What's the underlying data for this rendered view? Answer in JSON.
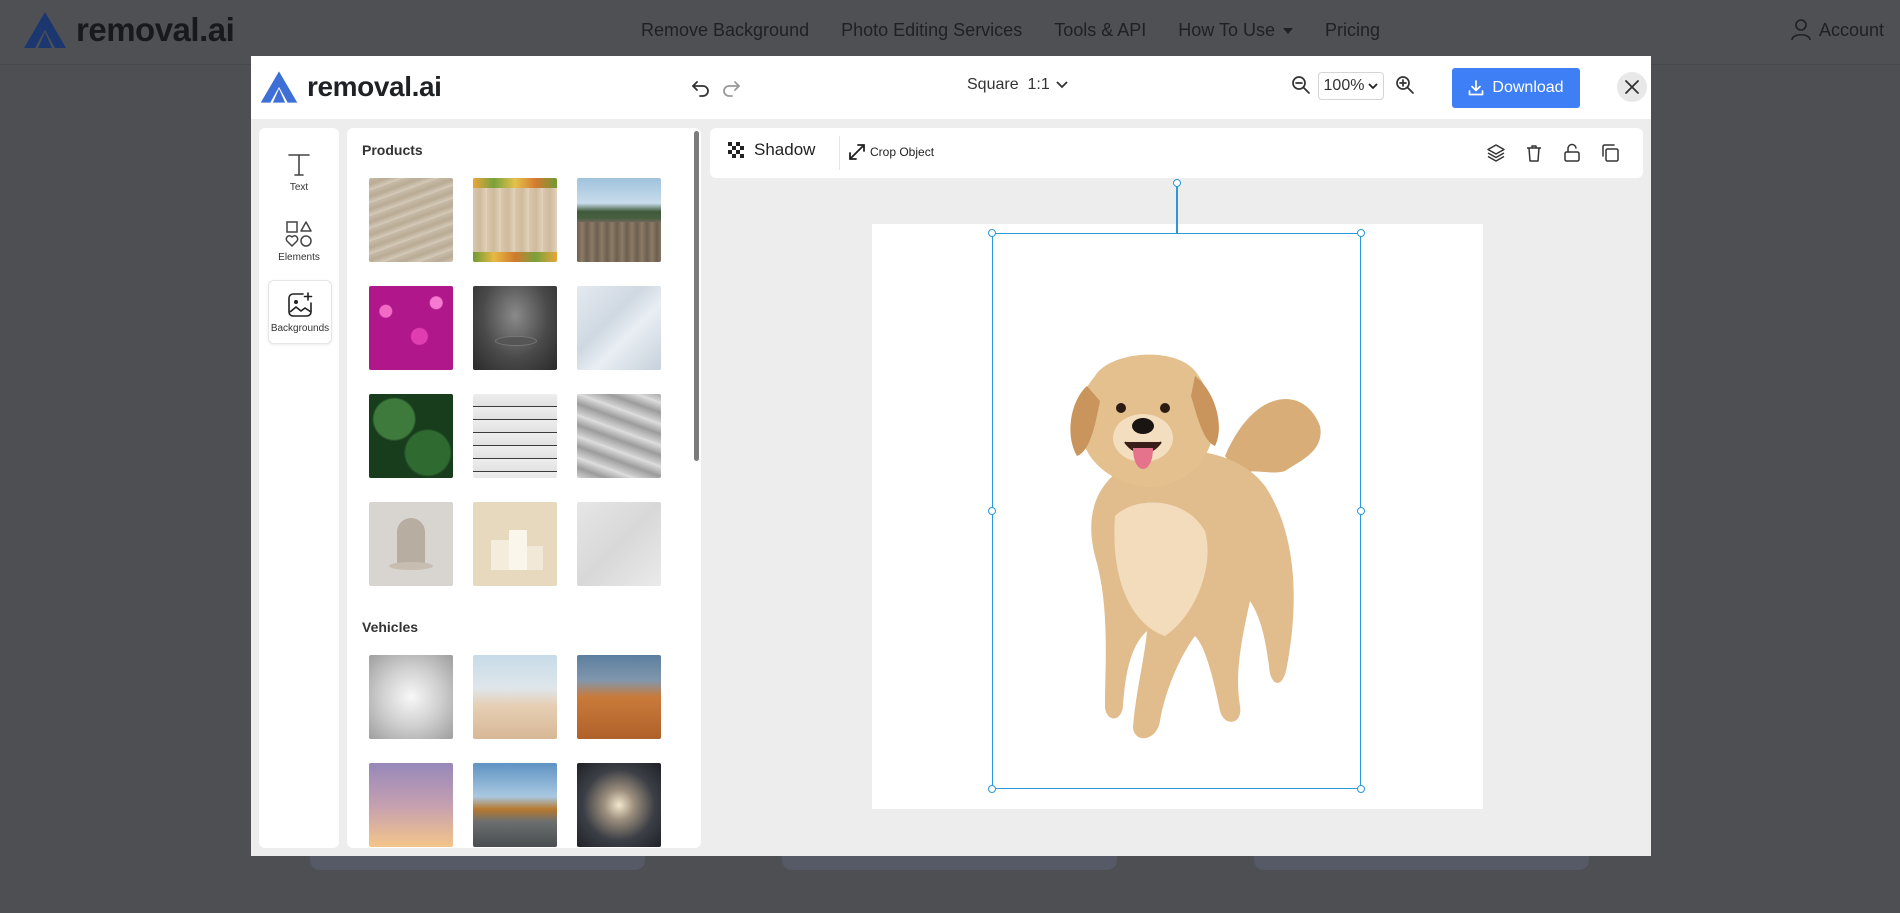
{
  "site": {
    "logo_text": "removal.ai",
    "nav": [
      "Remove Background",
      "Photo Editing Services",
      "Tools & API",
      "How To Use",
      "Pricing"
    ],
    "account_label": "Account"
  },
  "editor": {
    "logo_text": "removal.ai",
    "size_label": "Square  1:1",
    "zoom_value": "100%",
    "download_label": "Download",
    "rail": {
      "text_label": "Text",
      "elements_label": "Elements",
      "backgrounds_label": "Backgrounds"
    },
    "panel": {
      "products_title": "Products",
      "vehicles_title": "Vehicles"
    },
    "toolbar": {
      "shadow_label": "Shadow",
      "crop_label": "Crop Object"
    }
  },
  "colors": {
    "accent": "#3f7ff5",
    "selection": "#2b98d9",
    "brand_blue": "#3d6fd6"
  }
}
